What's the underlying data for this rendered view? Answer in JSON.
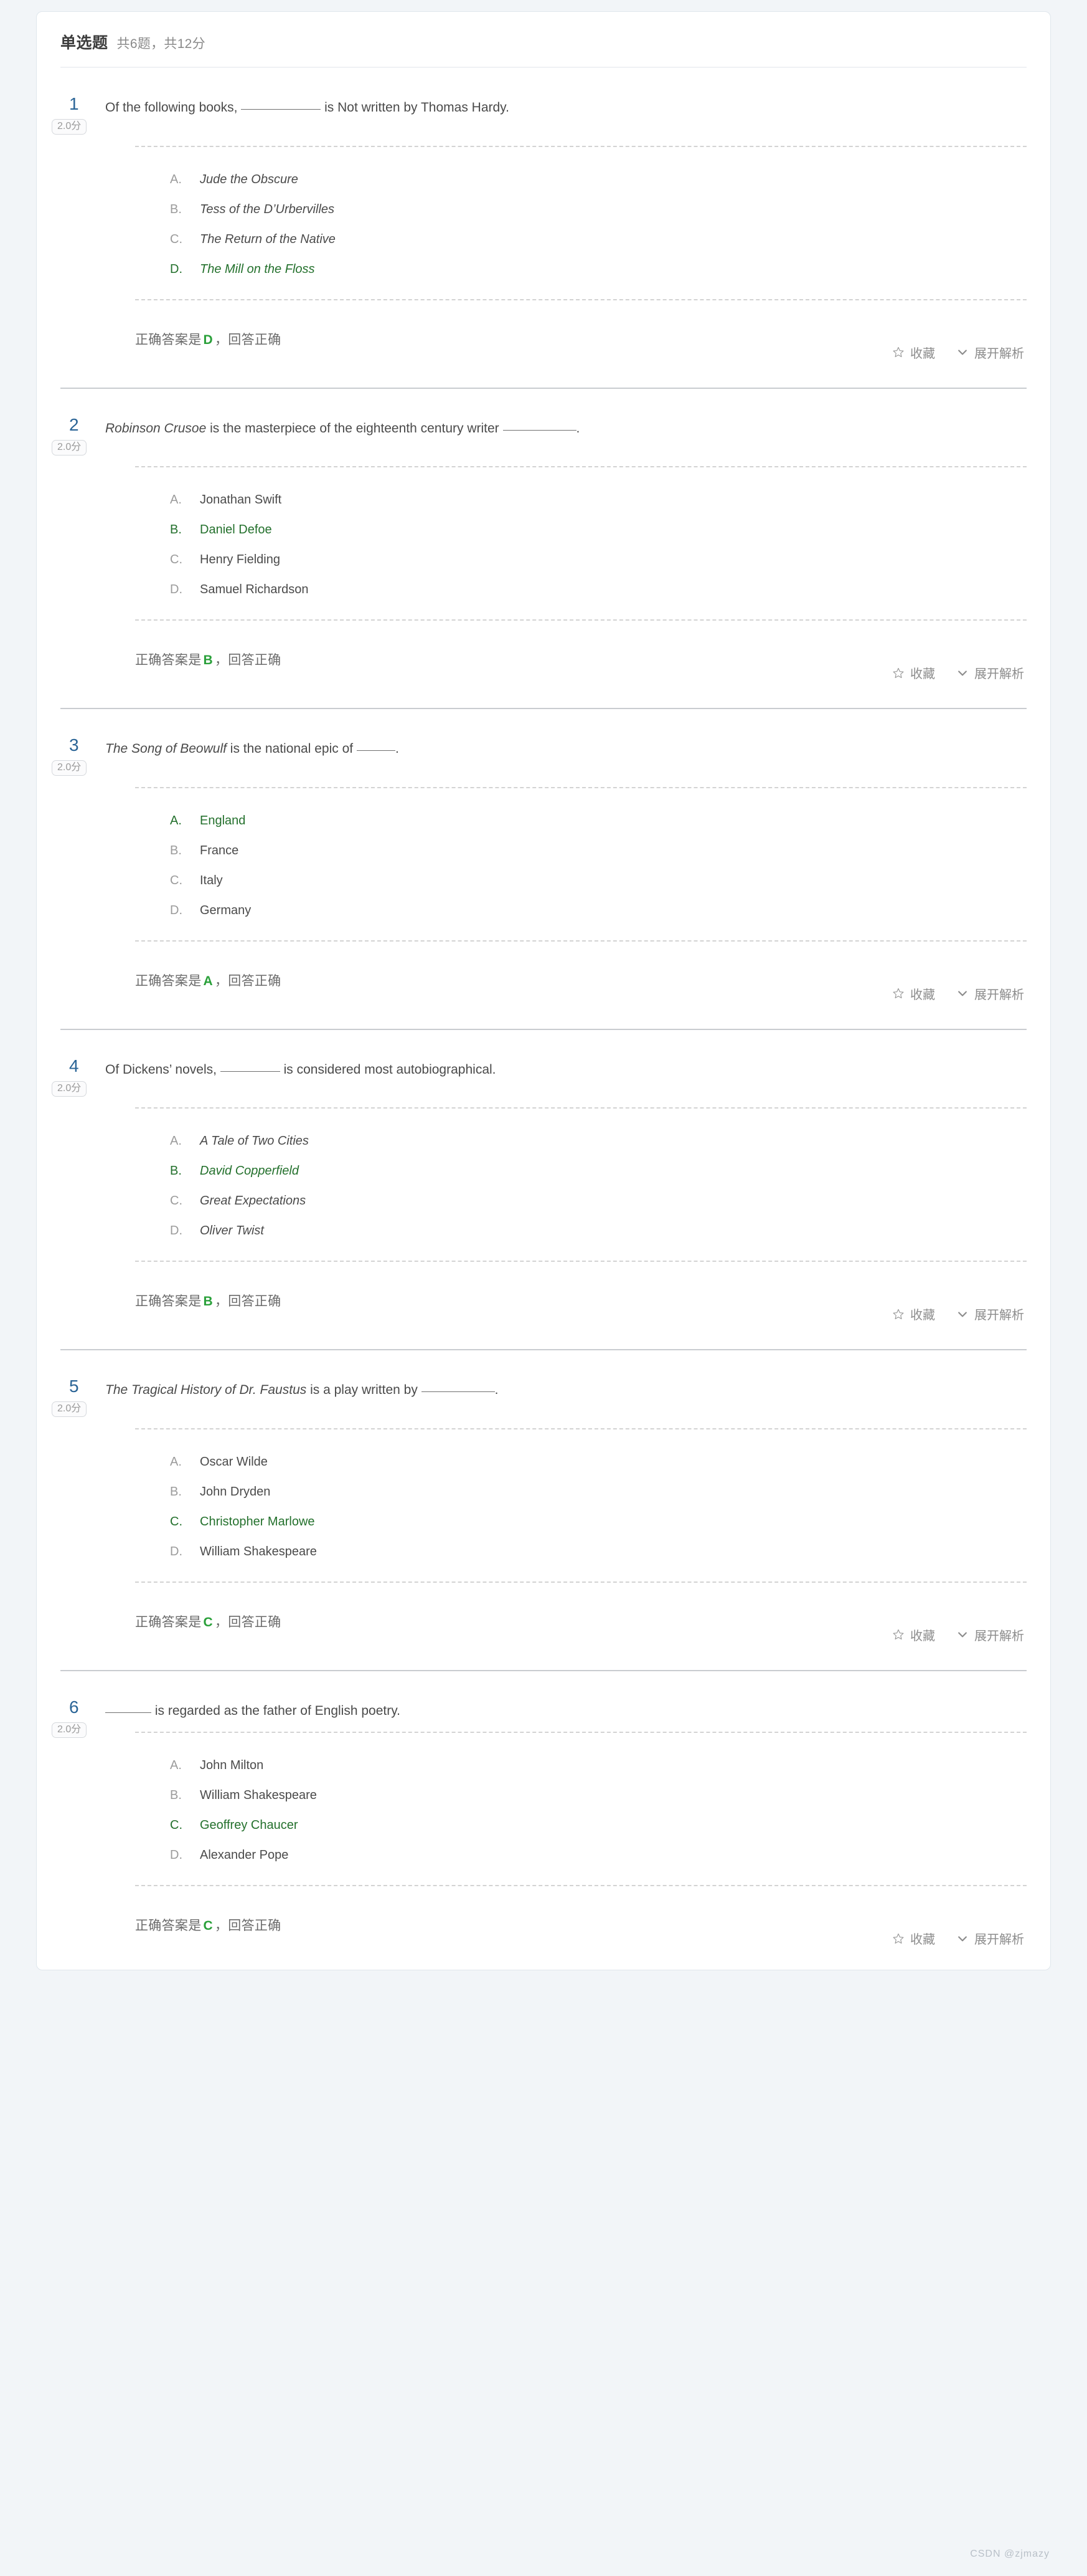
{
  "header": {
    "title": "单选题",
    "meta": "共6题，共12分"
  },
  "labels": {
    "score_badge": "2.0分",
    "answer_prefix": "正确答案是",
    "answer_suffix": "，回答正确",
    "favorite": "收藏",
    "expand_analysis": "展开解析",
    "star_icon": "star-outline-icon",
    "chevron_icon": "chevron-down-icon"
  },
  "accent_colors": {
    "number_blue": "#2a6496",
    "correct_green": "#23702c",
    "answer_green": "#2aa03a",
    "card_border": "#dfe6ec",
    "page_bg": "#f2f5f8"
  },
  "questions": [
    {
      "number": "1",
      "score": "2.0分",
      "stem_parts": [
        {
          "text": "Of the following books, ",
          "italic": false
        },
        {
          "blank": "w-xl"
        },
        {
          "text": " is Not written by Thomas Hardy.",
          "italic": false
        }
      ],
      "options": [
        {
          "letter": "A.",
          "text": "Jude the Obscure",
          "correct": false,
          "italic": true
        },
        {
          "letter": "B.",
          "text": "Tess of the D’Urbervilles",
          "correct": false,
          "italic": true
        },
        {
          "letter": "C.",
          "text": "The Return of the Native",
          "correct": false,
          "italic": true
        },
        {
          "letter": "D.",
          "text": "The Mill on the Floss",
          "correct": true,
          "italic": true
        }
      ],
      "answer_letter": "D"
    },
    {
      "number": "2",
      "score": "2.0分",
      "stem_parts": [
        {
          "text": "Robinson Crusoe",
          "italic": true
        },
        {
          "text": " is the masterpiece of the eighteenth century writer ",
          "italic": false
        },
        {
          "blank": "w-lg"
        },
        {
          "text": ".",
          "italic": false
        }
      ],
      "options": [
        {
          "letter": "A.",
          "text": "Jonathan Swift",
          "correct": false,
          "italic": false
        },
        {
          "letter": "B.",
          "text": "Daniel Defoe",
          "correct": true,
          "italic": false
        },
        {
          "letter": "C.",
          "text": "Henry Fielding",
          "correct": false,
          "italic": false
        },
        {
          "letter": "D.",
          "text": "Samuel Richardson",
          "correct": false,
          "italic": false
        }
      ],
      "answer_letter": "B"
    },
    {
      "number": "3",
      "score": "2.0分",
      "stem_parts": [
        {
          "text": "The Song of Beowulf",
          "italic": true
        },
        {
          "text": " is the national epic of ",
          "italic": false
        },
        {
          "blank": "w-sm"
        },
        {
          "text": ".",
          "italic": false
        }
      ],
      "options": [
        {
          "letter": "A.",
          "text": "England",
          "correct": true,
          "italic": false
        },
        {
          "letter": "B.",
          "text": "France",
          "correct": false,
          "italic": false
        },
        {
          "letter": "C.",
          "text": "Italy",
          "correct": false,
          "italic": false
        },
        {
          "letter": "D.",
          "text": "Germany",
          "correct": false,
          "italic": false
        }
      ],
      "answer_letter": "A"
    },
    {
      "number": "4",
      "score": "2.0分",
      "stem_parts": [
        {
          "text": "Of Dickens’ novels, ",
          "italic": false
        },
        {
          "blank": "w-md"
        },
        {
          "text": " is considered most autobiographical.",
          "italic": false
        }
      ],
      "options": [
        {
          "letter": "A.",
          "text": "A Tale of Two Cities",
          "correct": false,
          "italic": true
        },
        {
          "letter": "B.",
          "text": "David Copperfield",
          "correct": true,
          "italic": true
        },
        {
          "letter": "C.",
          "text": "Great Expectations",
          "correct": false,
          "italic": true
        },
        {
          "letter": "D.",
          "text": "Oliver Twist",
          "correct": false,
          "italic": true
        }
      ],
      "answer_letter": "B"
    },
    {
      "number": "5",
      "score": "2.0分",
      "stem_parts": [
        {
          "text": "The Tragical History of Dr. Faustus",
          "italic": true
        },
        {
          "text": " is a play written by ",
          "italic": false
        },
        {
          "blank": "w-lg"
        },
        {
          "text": ".",
          "italic": false
        }
      ],
      "options": [
        {
          "letter": "A.",
          "text": "Oscar Wilde",
          "correct": false,
          "italic": false
        },
        {
          "letter": "B.",
          "text": "John Dryden",
          "correct": false,
          "italic": false
        },
        {
          "letter": "C.",
          "text": "Christopher Marlowe",
          "correct": true,
          "italic": false
        },
        {
          "letter": "D.",
          "text": "William Shakespeare",
          "correct": false,
          "italic": false
        }
      ],
      "answer_letter": "C"
    },
    {
      "number": "6",
      "score": "2.0分",
      "stem_parts": [
        {
          "blank": "w-xs"
        },
        {
          "text": " is regarded as the father of English poetry.",
          "italic": false
        }
      ],
      "options": [
        {
          "letter": "A.",
          "text": "John Milton",
          "correct": false,
          "italic": false
        },
        {
          "letter": "B.",
          "text": "William Shakespeare",
          "correct": false,
          "italic": false
        },
        {
          "letter": "C.",
          "text": "Geoffrey Chaucer",
          "correct": true,
          "italic": false
        },
        {
          "letter": "D.",
          "text": "Alexander Pope",
          "correct": false,
          "italic": false
        }
      ],
      "answer_letter": "C"
    }
  ],
  "watermark": "CSDN @zjmazy"
}
